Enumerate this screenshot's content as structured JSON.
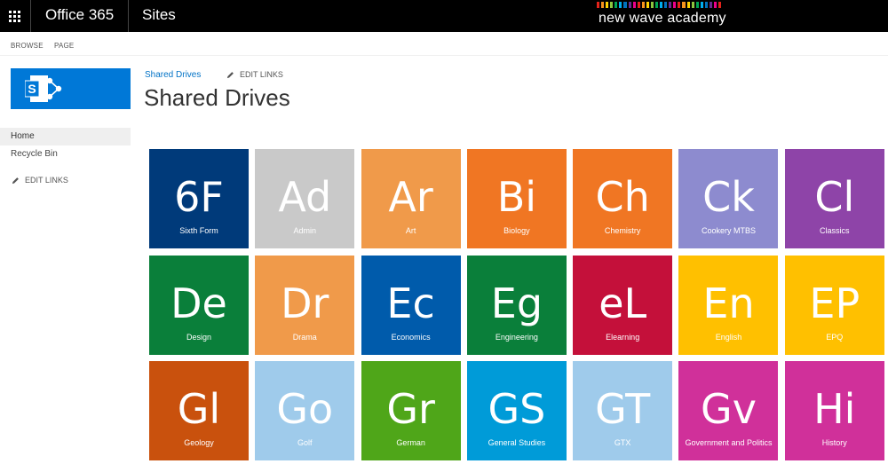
{
  "suite": {
    "brand": "Office 365",
    "app": "Sites",
    "org": "new wave academy",
    "stripe_colors": [
      "#e2231a",
      "#f7941d",
      "#ffd200",
      "#8dc63f",
      "#00a651",
      "#00aeef",
      "#0072bc",
      "#662d91",
      "#ec008c",
      "#e2231a",
      "#f7941d",
      "#ffd200",
      "#8dc63f",
      "#00a651",
      "#00aeef",
      "#0072bc",
      "#662d91",
      "#ec008c",
      "#e2231a",
      "#f7941d",
      "#ffd200",
      "#8dc63f",
      "#00a651",
      "#00aeef",
      "#0072bc",
      "#662d91",
      "#ec008c",
      "#e2231a"
    ]
  },
  "ribbon": {
    "browse": "BROWSE",
    "page": "PAGE"
  },
  "nav": {
    "items": [
      {
        "label": "Home",
        "selected": true
      },
      {
        "label": "Recycle Bin",
        "selected": false
      }
    ],
    "edit_links": "EDIT LINKS"
  },
  "title_area": {
    "breadcrumb": "Shared Drives",
    "edit_links": "EDIT LINKS",
    "title": "Shared Drives"
  },
  "colors": {
    "suite_bg": "#000000",
    "logo_bg": "#0078d7",
    "link": "#0072c6"
  },
  "tiles": [
    {
      "symbol": "6F",
      "name": "Sixth Form",
      "color": "#003a7a"
    },
    {
      "symbol": "Ad",
      "name": "Admin",
      "color": "#c9c9c9"
    },
    {
      "symbol": "Ar",
      "name": "Art",
      "color": "#f09a4a"
    },
    {
      "symbol": "Bi",
      "name": "Biology",
      "color": "#f07623"
    },
    {
      "symbol": "Ch",
      "name": "Chemistry",
      "color": "#f07623"
    },
    {
      "symbol": "Ck",
      "name": "Cookery MTBS",
      "color": "#8d8bcf"
    },
    {
      "symbol": "Cl",
      "name": "Classics",
      "color": "#8e44a8"
    },
    {
      "symbol": "De",
      "name": "Design",
      "color": "#0a7f3a"
    },
    {
      "symbol": "Dr",
      "name": "Drama",
      "color": "#f09a4a"
    },
    {
      "symbol": "Ec",
      "name": "Economics",
      "color": "#005bab"
    },
    {
      "symbol": "Eg",
      "name": "Engineering",
      "color": "#0a7f3a"
    },
    {
      "symbol": "eL",
      "name": "Elearning",
      "color": "#c4103a"
    },
    {
      "symbol": "En",
      "name": "English",
      "color": "#ffc000"
    },
    {
      "symbol": "EP",
      "name": "EPQ",
      "color": "#ffc000"
    },
    {
      "symbol": "Gl",
      "name": "Geology",
      "color": "#c9510d"
    },
    {
      "symbol": "Go",
      "name": "Golf",
      "color": "#9fcbeb"
    },
    {
      "symbol": "Gr",
      "name": "German",
      "color": "#4fa619"
    },
    {
      "symbol": "GS",
      "name": "General Studies",
      "color": "#009bd8"
    },
    {
      "symbol": "GT",
      "name": "GTX",
      "color": "#9fcbeb"
    },
    {
      "symbol": "Gv",
      "name": "Government and Politics",
      "color": "#d0309a"
    },
    {
      "symbol": "Hi",
      "name": "History",
      "color": "#d0309a"
    }
  ]
}
